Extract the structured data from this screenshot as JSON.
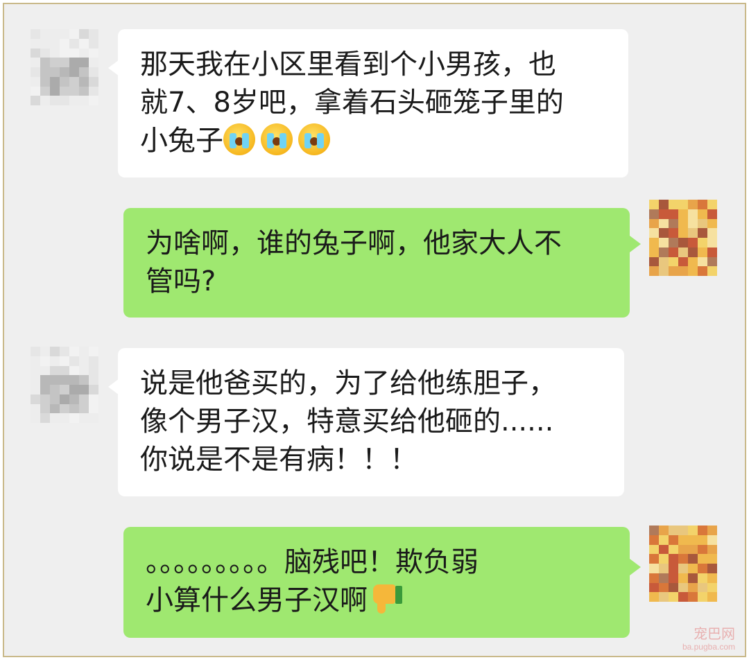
{
  "messages": [
    {
      "side": "left",
      "lines": [
        "那天我在小区里看到个小男孩，也",
        "就7、8岁吧，拿着石头砸笼子里的",
        "小兔子"
      ],
      "trailing_emoji": [
        "crying-face",
        "crying-face",
        "crying-face"
      ]
    },
    {
      "side": "right",
      "lines": [
        "为啥啊，谁的兔子啊，他家大人不",
        "管吗?"
      ]
    },
    {
      "side": "left",
      "lines": [
        "说是他爸买的，为了给他练胆子，",
        "像个男子汉，特意买给他砸的......",
        "你说是不是有病！！！"
      ]
    },
    {
      "side": "right",
      "lines": [
        "。。。。。。。。。脑残吧！欺负弱",
        "小算什么男子汉啊"
      ],
      "trailing_emoji": [
        "thumbs-down"
      ]
    }
  ],
  "watermark": {
    "line1": "宠巴网",
    "line2": "ba.pugba.com"
  },
  "colors": {
    "background": "#efefef",
    "frame_border": "#c9b98a",
    "left_bubble": "#ffffff",
    "right_bubble": "#9fe870"
  }
}
